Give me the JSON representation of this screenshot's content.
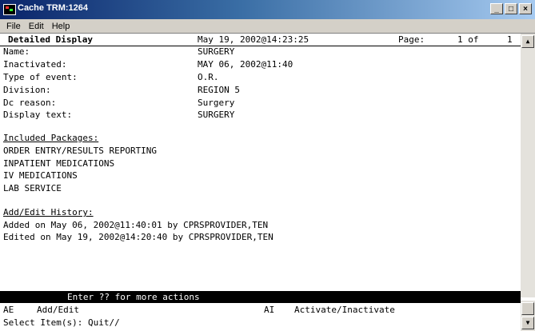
{
  "window": {
    "title": "Cache TRM:1264"
  },
  "menu": [
    "File",
    "Edit",
    "Help"
  ],
  "header": {
    "title": "Detailed Display",
    "datetime": "May 19, 2002@14:23:25",
    "page_label": "Page:",
    "page_current": "1 of",
    "page_total": "1"
  },
  "fields": [
    {
      "label": "Name:",
      "value": "SURGERY"
    },
    {
      "label": "Inactivated:",
      "value": "MAY 06, 2002@11:40"
    },
    {
      "label": "Type of event:",
      "value": "O.R."
    },
    {
      "label": "Division:",
      "value": "REGION 5"
    },
    {
      "label": "Dc reason:",
      "value": "Surgery"
    },
    {
      "label": "Display text:",
      "value": "SURGERY"
    }
  ],
  "packages": {
    "title": "Included Packages:",
    "items": [
      "ORDER ENTRY/RESULTS REPORTING",
      "INPATIENT MEDICATIONS",
      "IV MEDICATIONS",
      "LAB SERVICE"
    ]
  },
  "history": {
    "title": "Add/Edit History:",
    "items": [
      "Added on May 06, 2002@11:40:01 by CPRSPROVIDER,TEN",
      "Edited on May 19, 2002@14:20:40 by CPRSPROVIDER,TEN"
    ]
  },
  "status_bar": "Enter ?? for more actions",
  "actions": [
    {
      "code": "AE",
      "label": "Add/Edit"
    },
    {
      "code": "AI",
      "label": "Activate/Inactivate"
    }
  ],
  "prompt": "Select Item(s): Quit//"
}
